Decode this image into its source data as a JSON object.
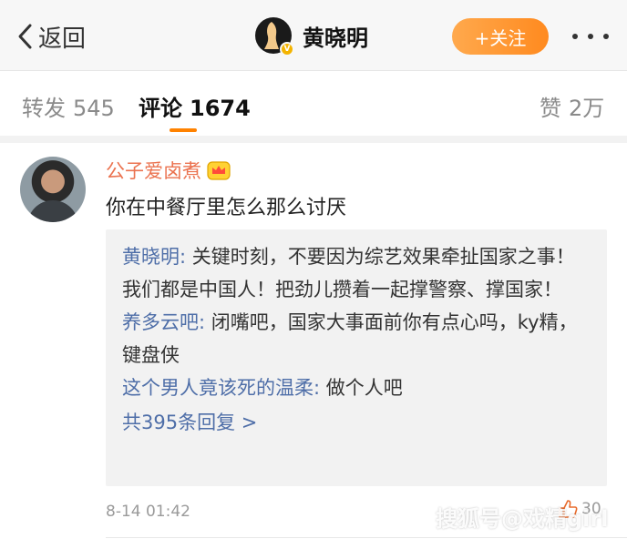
{
  "nav": {
    "back_label": "返回",
    "title": "黄晓明",
    "follow_label": "+关注"
  },
  "tabs": [
    {
      "label": "转发",
      "count": "545"
    },
    {
      "label": "评论",
      "count": "1674"
    },
    {
      "label": "赞",
      "count": "2万"
    }
  ],
  "comment": {
    "author": "公子爱卤煮",
    "text": "你在中餐厅里怎么那么讨厌",
    "replies": [
      {
        "name": "黄晓明:",
        "text": " 关键时刻，不要因为综艺效果牵扯国家之事！我们都是中国人！把劲儿攒着一起撑警察、撑国家！"
      },
      {
        "name": "养多云吧:",
        "text": " 闭嘴吧，国家大事面前你有点心吗，ky精，键盘侠"
      },
      {
        "name": "这个男人竟该死的温柔:",
        "text": " 做个人吧"
      }
    ],
    "more_replies": "共395条回复 >",
    "time": "8-14 01:42",
    "like_count": "30"
  },
  "watermark": "搜狐号@戏精girl",
  "colors": {
    "accent_orange": "#ff8200",
    "link_blue": "#4e6ea8",
    "author_orange": "#eb7350"
  },
  "icons": [
    "back-chevron-icon",
    "verified-badge-icon",
    "more-dots-icon",
    "crown-badge-icon",
    "like-thumb-icon"
  ]
}
